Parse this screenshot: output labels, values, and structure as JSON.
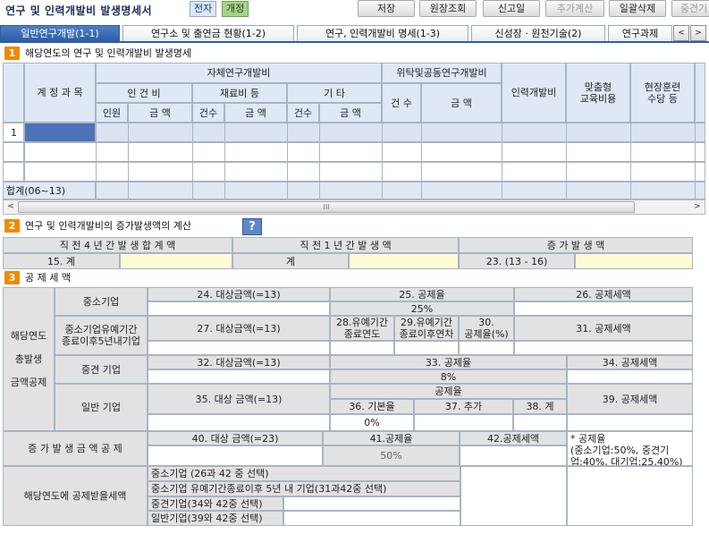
{
  "header": {
    "title": "연구 및 인력개발비 발생명세서",
    "badge_doc": "전자",
    "badge_rev": "개정",
    "buttons": {
      "save": "저장",
      "source_lookup": "원장조회",
      "report_date": "신고일",
      "add_calc": "추가계산",
      "delete_all": "일괄삭제",
      "mid": "중견기"
    }
  },
  "tabs": [
    "일반연구개발(1-1)",
    "연구소 및 출연금 현황(1-2)",
    "연구, 인력개발비 명세(1-3)",
    "신성장 · 원천기술(2)",
    "연구과제"
  ],
  "tab_nav": {
    "prev": "<",
    "next": ">"
  },
  "section1": {
    "num": "1",
    "title": "해당연도의 연구 및 인력개발비 발생명세",
    "cols": {
      "account": "계 정 과 목",
      "self_rd": "자체연구개발비",
      "labor": "인 건 비",
      "material": "재료비 등",
      "other": "기 타",
      "outsourced": "위탁및공동연구개발비",
      "people": "인원",
      "amount": "금 액",
      "count": "건수",
      "count2": "건 수",
      "hr_dev": "인력개발비",
      "custom_edu": "맞춤형\n교육비용",
      "field_training": "현장훈련\n수당 등"
    },
    "row_numbers": [
      "1",
      "",
      ""
    ],
    "total_label": "합계(06~13)",
    "scroll_thumb": "III"
  },
  "section2": {
    "num": "2",
    "title": "연구 및 인력개발비의 증가발생액의 계산",
    "help": "?",
    "headers": [
      "직 전 4 년 간 발 생 합 계 액",
      "직 전 1 년 간 발 생 액",
      "증     가     발     생     액"
    ],
    "row_labels": [
      "15.   계",
      "계",
      "23. (13 - 16)"
    ]
  },
  "section3": {
    "num": "3",
    "title": "공 제 세 액",
    "side_label": "해당연도\n\n총발생\n\n금액공제",
    "small": {
      "label": "중소기업",
      "h24": "24. 대상금액(=13)",
      "h25": "25. 공제율",
      "h26": "26. 공제세액",
      "rate": "25%"
    },
    "grace": {
      "label": "중소기업유예기간\n종료이후5년내기업",
      "h27": "27. 대상금액(=13)",
      "h28": "28.유예기간\n종료연도",
      "h29": "29.유예기간\n종료이후연차",
      "h30": "30.\n공제율(%)",
      "h31": "31. 공제세액"
    },
    "midsize": {
      "label": "중견 기업",
      "h32": "32. 대상금액(=13)",
      "h33": "33. 공제율",
      "h34": "34. 공제세액",
      "rate": "8%"
    },
    "general": {
      "label": "일반 기업",
      "h35": "35. 대상 금액(=13)",
      "rate_header": "공제율",
      "h36": "36. 기본율",
      "h37": "37. 추가",
      "h38": "38. 계",
      "h39": "39. 공제세액",
      "base_rate": "0%"
    },
    "increase": {
      "label": "증 가 발 생 금 액 공 제",
      "h40": "40. 대상 금액(=23)",
      "h41": "41.공제율",
      "h42": "42.공제세액",
      "rate": "50%",
      "note": "* 공제율\n(중소기업:50%, 중견기업:40%, 대기업:25,40%)"
    },
    "select": {
      "label": "해당연도에 공제받을세액",
      "options": [
        "중소기업 (26과 42 중 선택)",
        "중소기업 유예기간종료이후 5년 내 기업(31과42중 선택)",
        "중견기업(34와 42중 선택)",
        "일반기업(39와 42중 선택)"
      ]
    }
  },
  "colors": {
    "header_bg": "#dfe8f4",
    "gray_bg": "#e2e2e2",
    "yellow_bg": "#fffbd8",
    "tab_active": "#2d5ea6",
    "section_num": "#f08a00"
  }
}
